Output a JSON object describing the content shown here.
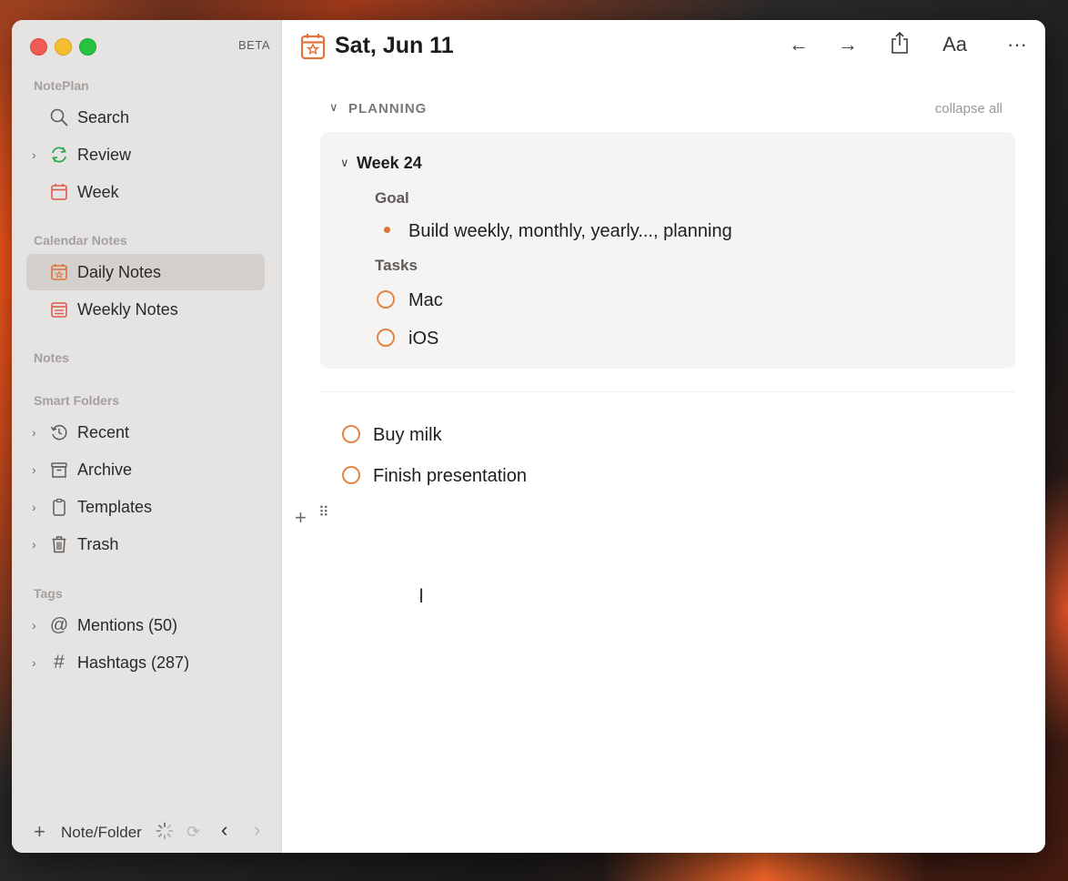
{
  "window": {
    "beta_label": "BETA"
  },
  "sidebar": {
    "notplan_header": "NotePlan",
    "top_items": [
      {
        "label": "Search",
        "icon": "search-icon"
      },
      {
        "label": "Review",
        "icon": "refresh-icon"
      },
      {
        "label": "Week",
        "icon": "calendar-icon"
      }
    ],
    "calendar_header": "Calendar Notes",
    "calendar_items": [
      {
        "label": "Daily Notes",
        "icon": "daily-calendar-icon",
        "selected": true
      },
      {
        "label": "Weekly Notes",
        "icon": "weekly-calendar-icon"
      }
    ],
    "notes_header": "Notes",
    "smart_header": "Smart Folders",
    "smart_items": [
      {
        "label": "Recent",
        "icon": "clock-icon"
      },
      {
        "label": "Archive",
        "icon": "archive-icon"
      },
      {
        "label": "Templates",
        "icon": "clipboard-icon"
      },
      {
        "label": "Trash",
        "icon": "trash-icon"
      }
    ],
    "tags_header": "Tags",
    "tag_items": [
      {
        "label": "Mentions (50)",
        "icon": "at-icon"
      },
      {
        "label": "Hashtags (287)",
        "icon": "hash-icon"
      }
    ],
    "footer": {
      "new_label": "Note/Folder"
    }
  },
  "editor": {
    "title": "Sat, Jun 11",
    "planning_label": "PLANNING",
    "collapse_label": "collapse all",
    "week_label": "Week 24",
    "goal_label": "Goal",
    "goal_item": "Build weekly, monthly, yearly..., planning",
    "tasks_label": "Tasks",
    "tasks": [
      "Mac",
      "iOS"
    ],
    "todos": [
      "Buy milk",
      "Finish presentation"
    ],
    "toolbar": {
      "back": "←",
      "forward": "→",
      "share": "⇪",
      "font": "Aa",
      "more": "···"
    }
  },
  "colors": {
    "accent": "#e08646",
    "sidebar_bg": "#e6e4e3",
    "selected_bg": "#d3d0ce"
  }
}
